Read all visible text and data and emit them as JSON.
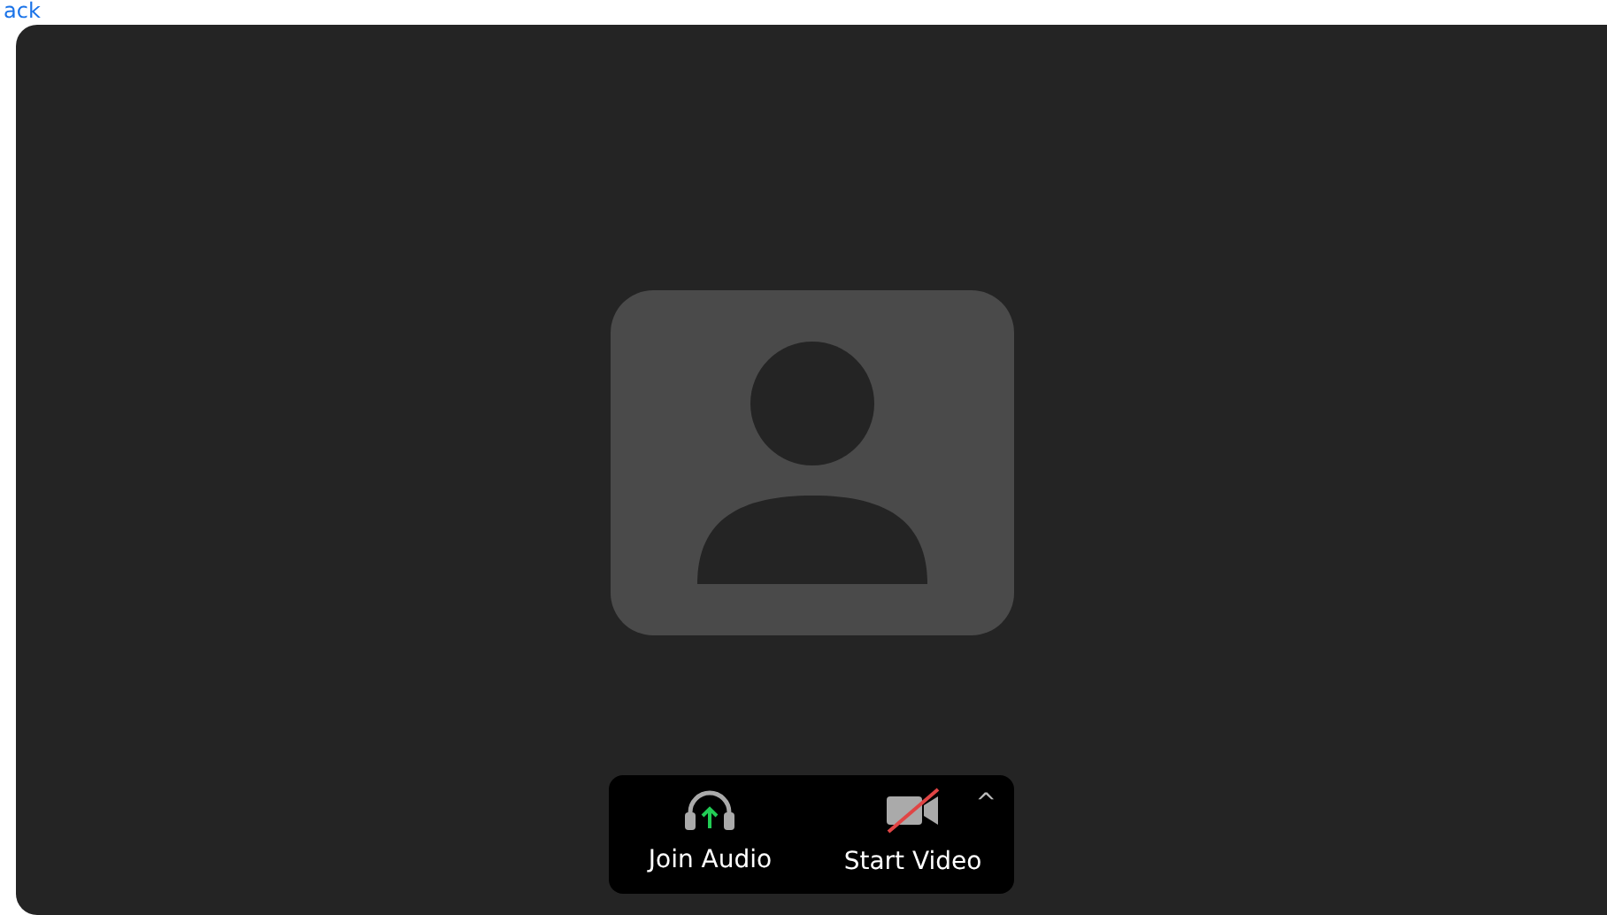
{
  "back_link": {
    "label": "ack"
  },
  "controls": [
    {
      "kind": "audio",
      "label": "Join Audio"
    },
    {
      "kind": "video",
      "label": "Start Video",
      "muted": true,
      "caret": "^"
    }
  ]
}
